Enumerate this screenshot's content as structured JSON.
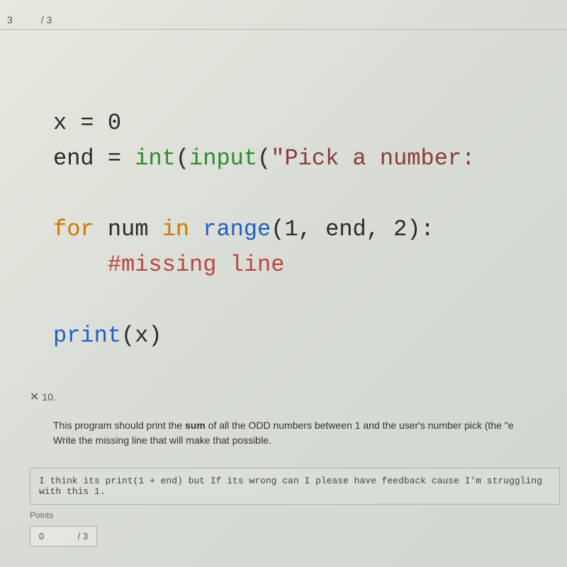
{
  "header": {
    "score_earned": "3",
    "score_total": "/ 3"
  },
  "code": {
    "line1_var": "x ",
    "line1_eq": "= ",
    "line1_val": "0",
    "line2_var": "end ",
    "line2_eq": "= ",
    "line2_int": "int",
    "line2_open": "(",
    "line2_input": "input",
    "line2_paren": "(",
    "line2_str": "\"Pick a number:",
    "line3_for": "for",
    "line3_num": " num ",
    "line3_in": "in",
    "line3_range": " range",
    "line3_args": "(1, end, 2):",
    "line4_comment": "    #missing line",
    "line5_print": "print",
    "line5_open": "(",
    "line5_x": "x",
    "line5_close": ")"
  },
  "question": {
    "number": "10.",
    "text_part1": "This program should print the ",
    "text_sum": "sum",
    "text_part2": " of all the ODD numbers between 1 and the user's number pick (the \"e",
    "text_line2": "Write the missing line that will make that possible."
  },
  "answer": {
    "text": "I think its print(1 + end) but If its wrong can I please have feedback cause I'm struggling with this 1."
  },
  "footer": {
    "label": "Points",
    "earned": "0",
    "total": "/ 3"
  }
}
